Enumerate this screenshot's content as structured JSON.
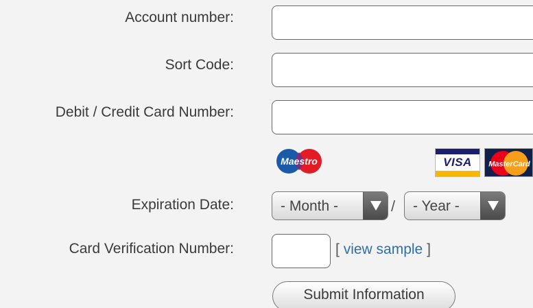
{
  "form": {
    "account_number": {
      "label": "Account number:",
      "value": ""
    },
    "sort_code": {
      "label": "Sort Code:",
      "value": ""
    },
    "card_number": {
      "label": "Debit / Credit Card Number:",
      "value": ""
    },
    "card_logos": {
      "maestro": "Maestro",
      "visa": "VISA",
      "mastercard": "MasterCard"
    },
    "expiration": {
      "label": "Expiration Date:",
      "month_selected": "- Month -",
      "separator": "/",
      "year_selected": "- Year -"
    },
    "cvv": {
      "label": "Card Verification Number:",
      "value": "",
      "sample_open": "[",
      "sample_link": "view sample",
      "sample_close": "]"
    },
    "submit_label": "Submit Information"
  },
  "colors": {
    "background": "#f3f3f3",
    "link": "#2e6fa7",
    "maestro_red": "#e21b24",
    "maestro_blue": "#1a5aa8",
    "visa_blue": "#1a1f71",
    "visa_gold": "#f7b600",
    "mastercard_red": "#eb001b",
    "mastercard_orange": "#f79e1b"
  }
}
